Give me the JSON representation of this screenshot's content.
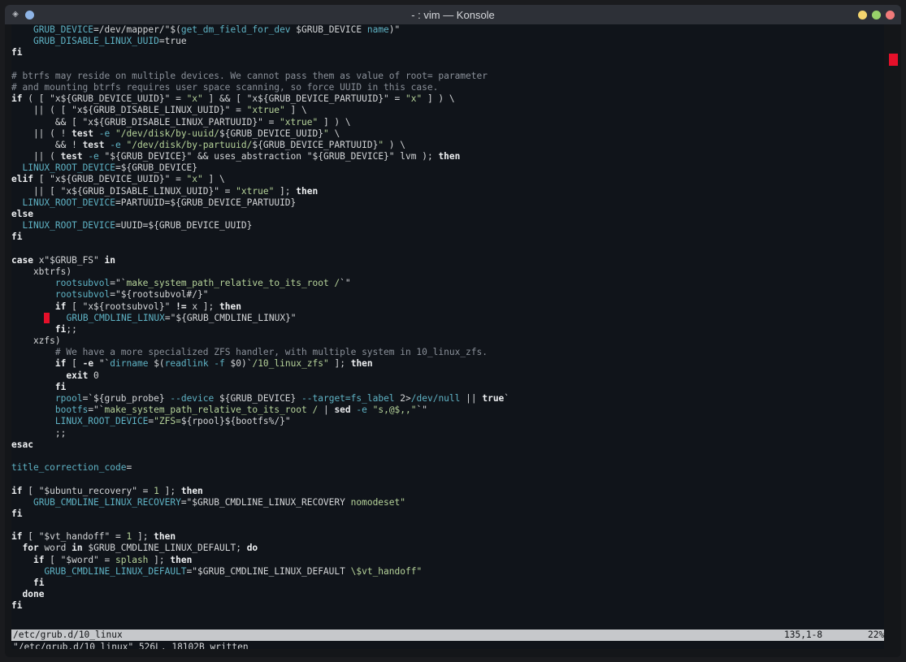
{
  "window": {
    "title": "- : vim — Konsole"
  },
  "editor": {
    "lines": [
      [
        [
          "    ",
          "p"
        ],
        [
          "GRUB_DEVICE",
          "v"
        ],
        [
          "=/dev/mapper/\"$(",
          "p"
        ],
        [
          "get_dm_field_for_dev",
          "v"
        ],
        [
          " $GRUB_DEVICE ",
          "p"
        ],
        [
          "name",
          "v"
        ],
        [
          ")\"",
          "p"
        ]
      ],
      [
        [
          "    ",
          "p"
        ],
        [
          "GRUB_DISABLE_LINUX_UUID",
          "v"
        ],
        [
          "=true",
          "p"
        ]
      ],
      [
        [
          "fi",
          "k"
        ]
      ],
      [
        [
          "",
          "p"
        ]
      ],
      [
        [
          "# btrfs may reside on multiple devices. We cannot pass them as value of root= parameter",
          "c"
        ]
      ],
      [
        [
          "# and mounting btrfs requires user space scanning, so force UUID in this case.",
          "c"
        ]
      ],
      [
        [
          "if",
          "k"
        ],
        [
          " ( [ \"x${GRUB_DEVICE_UUID}\" = ",
          "p"
        ],
        [
          "\"x\"",
          "s"
        ],
        [
          " ] && [ \"x${GRUB_DEVICE_PARTUUID}\" = ",
          "p"
        ],
        [
          "\"x\"",
          "s"
        ],
        [
          " ] ) \\",
          "p"
        ]
      ],
      [
        [
          "    || ( [ \"x${GRUB_DISABLE_LINUX_UUID}\" = ",
          "p"
        ],
        [
          "\"xtrue\"",
          "s"
        ],
        [
          " ] \\",
          "p"
        ]
      ],
      [
        [
          "        && [ \"x${GRUB_DISABLE_LINUX_PARTUUID}\" = ",
          "p"
        ],
        [
          "\"xtrue\"",
          "s"
        ],
        [
          " ] ) \\",
          "p"
        ]
      ],
      [
        [
          "    || ( ! ",
          "p"
        ],
        [
          "test",
          "m"
        ],
        [
          " -e ",
          "v"
        ],
        [
          "\"/dev/disk/by-uuid/",
          "s"
        ],
        [
          "${GRUB_DEVICE_UUID}",
          "p"
        ],
        [
          "\"",
          "s"
        ],
        [
          " \\",
          "p"
        ]
      ],
      [
        [
          "        && ! ",
          "p"
        ],
        [
          "test",
          "m"
        ],
        [
          " -e ",
          "v"
        ],
        [
          "\"/dev/disk/by-partuuid/",
          "s"
        ],
        [
          "${GRUB_DEVICE_PARTUUID}",
          "p"
        ],
        [
          "\"",
          "s"
        ],
        [
          " ) \\",
          "p"
        ]
      ],
      [
        [
          "    || ( ",
          "p"
        ],
        [
          "test",
          "m"
        ],
        [
          " -e ",
          "v"
        ],
        [
          "\"${GRUB_DEVICE}\"",
          "p"
        ],
        [
          " && uses_abstraction ",
          "p"
        ],
        [
          "\"${GRUB_DEVICE}\"",
          "p"
        ],
        [
          " lvm ); ",
          "p"
        ],
        [
          "then",
          "k"
        ]
      ],
      [
        [
          "  ",
          "p"
        ],
        [
          "LINUX_ROOT_DEVICE",
          "v"
        ],
        [
          "=${GRUB_DEVICE}",
          "p"
        ]
      ],
      [
        [
          "elif",
          "k"
        ],
        [
          " [ \"x${GRUB_DEVICE_UUID}\" = ",
          "p"
        ],
        [
          "\"x\"",
          "s"
        ],
        [
          " ] \\",
          "p"
        ]
      ],
      [
        [
          "    || [ \"x${GRUB_DISABLE_LINUX_UUID}\" = ",
          "p"
        ],
        [
          "\"xtrue\"",
          "s"
        ],
        [
          " ]; ",
          "p"
        ],
        [
          "then",
          "k"
        ]
      ],
      [
        [
          "  ",
          "p"
        ],
        [
          "LINUX_ROOT_DEVICE",
          "v"
        ],
        [
          "=PARTUUID=${GRUB_DEVICE_PARTUUID}",
          "p"
        ]
      ],
      [
        [
          "else",
          "k"
        ]
      ],
      [
        [
          "  ",
          "p"
        ],
        [
          "LINUX_ROOT_DEVICE",
          "v"
        ],
        [
          "=UUID=${GRUB_DEVICE_UUID}",
          "p"
        ]
      ],
      [
        [
          "fi",
          "k"
        ]
      ],
      [
        [
          "",
          "p"
        ]
      ],
      [
        [
          "case",
          "k"
        ],
        [
          " x\"$GRUB_FS\" ",
          "p"
        ],
        [
          "in",
          "k"
        ]
      ],
      [
        [
          "    xbtrfs)",
          "p"
        ]
      ],
      [
        [
          "        ",
          "p"
        ],
        [
          "rootsubvol",
          "v"
        ],
        [
          "=\"`",
          "p"
        ],
        [
          "make_system_path_relative_to_its_root /",
          "s"
        ],
        [
          "`\"",
          "p"
        ]
      ],
      [
        [
          "        ",
          "p"
        ],
        [
          "rootsubvol",
          "v"
        ],
        [
          "=\"${rootsubvol#/}\"",
          "p"
        ]
      ],
      [
        [
          "        ",
          "p"
        ],
        [
          "if",
          "k"
        ],
        [
          " [ \"x${rootsubvol}\" ",
          "p"
        ],
        [
          "!=",
          "k"
        ],
        [
          " x ]; ",
          "p"
        ],
        [
          "then",
          "k"
        ]
      ],
      [
        [
          "      ",
          "p"
        ],
        [
          "CURSOR",
          "x"
        ],
        [
          "   ",
          "p"
        ],
        [
          "GRUB_CMDLINE_LINUX",
          "v"
        ],
        [
          "=\"${GRUB_CMDLINE_LINUX}\"",
          "p"
        ]
      ],
      [
        [
          "        ",
          "p"
        ],
        [
          "fi",
          "k"
        ],
        [
          ";;",
          "p"
        ]
      ],
      [
        [
          "    xzfs)",
          "p"
        ]
      ],
      [
        [
          "        ",
          "p"
        ],
        [
          "# We have a more specialized ZFS handler, with multiple system in 10_linux_zfs.",
          "c"
        ]
      ],
      [
        [
          "        ",
          "p"
        ],
        [
          "if",
          "k"
        ],
        [
          " [ ",
          "p"
        ],
        [
          "-e",
          "m"
        ],
        [
          " \"`",
          "p"
        ],
        [
          "dirname",
          "v"
        ],
        [
          " $(",
          "p"
        ],
        [
          "readlink -f",
          "v"
        ],
        [
          " $0)`",
          "p"
        ],
        [
          "/10_linux_zfs\"",
          "s"
        ],
        [
          " ]; ",
          "p"
        ],
        [
          "then",
          "k"
        ]
      ],
      [
        [
          "          ",
          "p"
        ],
        [
          "exit",
          "k"
        ],
        [
          " 0",
          "p"
        ]
      ],
      [
        [
          "        ",
          "p"
        ],
        [
          "fi",
          "k"
        ]
      ],
      [
        [
          "        ",
          "p"
        ],
        [
          "rpool",
          "v"
        ],
        [
          "=`${grub_probe} ",
          "p"
        ],
        [
          "--device",
          "v"
        ],
        [
          " ${GRUB_DEVICE} ",
          "p"
        ],
        [
          "--target=fs_label",
          "v"
        ],
        [
          " 2>",
          "p"
        ],
        [
          "/dev/null",
          "v"
        ],
        [
          " || ",
          "p"
        ],
        [
          "true",
          "k"
        ],
        [
          "`",
          "p"
        ]
      ],
      [
        [
          "        ",
          "p"
        ],
        [
          "bootfs",
          "v"
        ],
        [
          "=\"`",
          "p"
        ],
        [
          "make_system_path_relative_to_its_root /",
          "s"
        ],
        [
          " | ",
          "p"
        ],
        [
          "sed",
          "m"
        ],
        [
          " -e ",
          "v"
        ],
        [
          "\"s,@$,,\"",
          "s"
        ],
        [
          "`\"",
          "p"
        ]
      ],
      [
        [
          "        ",
          "p"
        ],
        [
          "LINUX_ROOT_DEVICE",
          "v"
        ],
        [
          "=",
          "p"
        ],
        [
          "\"ZFS=",
          "s"
        ],
        [
          "${rpool}${bootfs%/}\"",
          "p"
        ]
      ],
      [
        [
          "        ;;",
          "p"
        ]
      ],
      [
        [
          "esac",
          "k"
        ]
      ],
      [
        [
          "",
          "p"
        ]
      ],
      [
        [
          "title_correction_code",
          "v"
        ],
        [
          "=",
          "p"
        ]
      ],
      [
        [
          "",
          "p"
        ]
      ],
      [
        [
          "if",
          "k"
        ],
        [
          " [ \"$ubuntu_recovery\" = ",
          "p"
        ],
        [
          "1",
          "s"
        ],
        [
          " ]; ",
          "p"
        ],
        [
          "then",
          "k"
        ]
      ],
      [
        [
          "    ",
          "p"
        ],
        [
          "GRUB_CMDLINE_LINUX_RECOVERY",
          "v"
        ],
        [
          "=\"$GRUB_CMDLINE_LINUX_RECOVERY ",
          "p"
        ],
        [
          "nomodeset\"",
          "s"
        ]
      ],
      [
        [
          "fi",
          "k"
        ]
      ],
      [
        [
          "",
          "p"
        ]
      ],
      [
        [
          "if",
          "k"
        ],
        [
          " [ \"$vt_handoff\" = ",
          "p"
        ],
        [
          "1",
          "s"
        ],
        [
          " ]; ",
          "p"
        ],
        [
          "then",
          "k"
        ]
      ],
      [
        [
          "  ",
          "p"
        ],
        [
          "for",
          "k"
        ],
        [
          " word ",
          "p"
        ],
        [
          "in",
          "k"
        ],
        [
          " $GRUB_CMDLINE_LINUX_DEFAULT; ",
          "p"
        ],
        [
          "do",
          "k"
        ]
      ],
      [
        [
          "    ",
          "p"
        ],
        [
          "if",
          "k"
        ],
        [
          " [ \"$word\" = ",
          "p"
        ],
        [
          "splash",
          "s"
        ],
        [
          " ]; ",
          "p"
        ],
        [
          "then",
          "k"
        ]
      ],
      [
        [
          "      ",
          "p"
        ],
        [
          "GRUB_CMDLINE_LINUX_DEFAULT",
          "v"
        ],
        [
          "=\"$GRUB_CMDLINE_LINUX_DEFAULT ",
          "p"
        ],
        [
          "\\$vt_handoff\"",
          "s"
        ]
      ],
      [
        [
          "    ",
          "p"
        ],
        [
          "fi",
          "k"
        ]
      ],
      [
        [
          "  ",
          "p"
        ],
        [
          "done",
          "k"
        ]
      ],
      [
        [
          "fi",
          "k"
        ]
      ]
    ]
  },
  "statusline": {
    "filename": "/etc/grub.d/10_linux",
    "position": "135,1-8",
    "percent": "22%"
  },
  "message": "\"/etc/grub.d/10_linux\" 526L, 18102B written",
  "colors": {
    "background": "#10141a",
    "variable": "#5fb3c5",
    "string": "#b6d39a",
    "comment": "#8a9099",
    "cursor": "#e5102a"
  },
  "scrollbar": {
    "thumb_position_fraction": 0.22
  }
}
